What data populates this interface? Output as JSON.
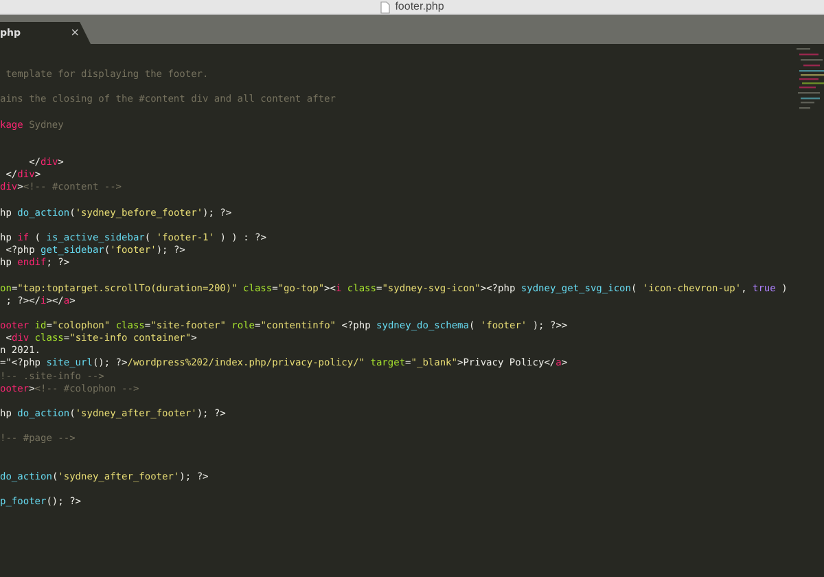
{
  "window": {
    "title": "footer.php"
  },
  "tabs": [
    {
      "label": "php",
      "close": "×",
      "selected": true
    }
  ],
  "editor": {
    "lines": [
      {
        "blank": true
      },
      {
        "tokens": [
          {
            "kind": "comment",
            "text": " template for displaying the footer."
          }
        ]
      },
      {
        "blank": true
      },
      {
        "tokens": [
          {
            "kind": "comment",
            "text": "ains the closing of the #content div and all content after"
          }
        ]
      },
      {
        "blank": true
      },
      {
        "tokens": [
          {
            "kind": "keyword",
            "text": "kage"
          },
          {
            "kind": "comment",
            "text": " Sydney"
          }
        ]
      },
      {
        "blank": true
      },
      {
        "blank": true
      },
      {
        "tokens": [
          {
            "kind": "plain",
            "text": "     </"
          },
          {
            "kind": "keyword",
            "text": "div"
          },
          {
            "kind": "plain",
            "text": ">"
          }
        ]
      },
      {
        "tokens": [
          {
            "kind": "plain",
            "text": " </"
          },
          {
            "kind": "keyword",
            "text": "div"
          },
          {
            "kind": "plain",
            "text": ">"
          }
        ]
      },
      {
        "tokens": [
          {
            "kind": "keyword",
            "text": "div"
          },
          {
            "kind": "plain",
            "text": ">"
          },
          {
            "kind": "comment",
            "text": "<!-- #content -->"
          }
        ]
      },
      {
        "blank": true
      },
      {
        "tokens": [
          {
            "kind": "plain",
            "text": "hp "
          },
          {
            "kind": "func",
            "text": "do_action"
          },
          {
            "kind": "plain",
            "text": "("
          },
          {
            "kind": "string",
            "text": "'sydney_before_footer'"
          },
          {
            "kind": "plain",
            "text": "); ?>"
          }
        ]
      },
      {
        "blank": true
      },
      {
        "tokens": [
          {
            "kind": "plain",
            "text": "hp "
          },
          {
            "kind": "keyword",
            "text": "if"
          },
          {
            "kind": "plain",
            "text": " ( "
          },
          {
            "kind": "func",
            "text": "is_active_sidebar"
          },
          {
            "kind": "plain",
            "text": "( "
          },
          {
            "kind": "string",
            "text": "'footer-1'"
          },
          {
            "kind": "plain",
            "text": " ) ) : ?>"
          }
        ]
      },
      {
        "tokens": [
          {
            "kind": "plain",
            "text": " <?php "
          },
          {
            "kind": "func",
            "text": "get_sidebar"
          },
          {
            "kind": "plain",
            "text": "("
          },
          {
            "kind": "string",
            "text": "'footer'"
          },
          {
            "kind": "plain",
            "text": "); ?>"
          }
        ]
      },
      {
        "tokens": [
          {
            "kind": "plain",
            "text": "hp "
          },
          {
            "kind": "keyword",
            "text": "endif"
          },
          {
            "kind": "plain",
            "text": "; ?>"
          }
        ]
      },
      {
        "blank": true
      },
      {
        "tokens": [
          {
            "kind": "attr",
            "text": "on"
          },
          {
            "kind": "plain",
            "text": "="
          },
          {
            "kind": "string",
            "text": "\"tap:toptarget.scrollTo(duration=200)\""
          },
          {
            "kind": "attr",
            "text": " class"
          },
          {
            "kind": "plain",
            "text": "="
          },
          {
            "kind": "string",
            "text": "\"go-top\""
          },
          {
            "kind": "plain",
            "text": "><"
          },
          {
            "kind": "keyword",
            "text": "i"
          },
          {
            "kind": "attr",
            "text": " class"
          },
          {
            "kind": "plain",
            "text": "="
          },
          {
            "kind": "string",
            "text": "\"sydney-svg-icon\""
          },
          {
            "kind": "plain",
            "text": "><?php "
          },
          {
            "kind": "func",
            "text": "sydney_get_svg_icon"
          },
          {
            "kind": "plain",
            "text": "( "
          },
          {
            "kind": "string",
            "text": "'icon-chevron-up'"
          },
          {
            "kind": "plain",
            "text": ", "
          },
          {
            "kind": "constant",
            "text": "true"
          },
          {
            "kind": "plain",
            "text": " )"
          }
        ]
      },
      {
        "tokens": [
          {
            "kind": "plain",
            "text": " ; ?></"
          },
          {
            "kind": "keyword",
            "text": "i"
          },
          {
            "kind": "plain",
            "text": "></"
          },
          {
            "kind": "keyword",
            "text": "a"
          },
          {
            "kind": "plain",
            "text": ">"
          }
        ]
      },
      {
        "blank": true
      },
      {
        "tokens": [
          {
            "kind": "keyword",
            "text": "ooter"
          },
          {
            "kind": "attr",
            "text": " id"
          },
          {
            "kind": "plain",
            "text": "="
          },
          {
            "kind": "string",
            "text": "\"colophon\""
          },
          {
            "kind": "attr",
            "text": " class"
          },
          {
            "kind": "plain",
            "text": "="
          },
          {
            "kind": "string",
            "text": "\"site-footer\""
          },
          {
            "kind": "attr",
            "text": " role"
          },
          {
            "kind": "plain",
            "text": "="
          },
          {
            "kind": "string",
            "text": "\"contentinfo\""
          },
          {
            "kind": "plain",
            "text": " <?php "
          },
          {
            "kind": "func",
            "text": "sydney_do_schema"
          },
          {
            "kind": "plain",
            "text": "( "
          },
          {
            "kind": "string",
            "text": "'footer'"
          },
          {
            "kind": "plain",
            "text": " ); ?>>"
          }
        ]
      },
      {
        "tokens": [
          {
            "kind": "plain",
            "text": " <"
          },
          {
            "kind": "keyword",
            "text": "div"
          },
          {
            "kind": "attr",
            "text": " class"
          },
          {
            "kind": "plain",
            "text": "="
          },
          {
            "kind": "string",
            "text": "\"site-info container\""
          },
          {
            "kind": "plain",
            "text": ">"
          }
        ]
      },
      {
        "tokens": [
          {
            "kind": "plain",
            "text": "n 2021."
          }
        ]
      },
      {
        "tokens": [
          {
            "kind": "plain",
            "text": "=\"<?php "
          },
          {
            "kind": "func",
            "text": "site_url"
          },
          {
            "kind": "plain",
            "text": "(); ?>"
          },
          {
            "kind": "string",
            "text": "/wordpress%202/index.php/privacy-policy/\""
          },
          {
            "kind": "attr",
            "text": " target"
          },
          {
            "kind": "plain",
            "text": "="
          },
          {
            "kind": "string",
            "text": "\"_blank\""
          },
          {
            "kind": "plain",
            "text": ">Privacy Policy</"
          },
          {
            "kind": "keyword",
            "text": "a"
          },
          {
            "kind": "plain",
            "text": ">"
          }
        ]
      },
      {
        "tokens": [
          {
            "kind": "comment",
            "text": "!-- .site-info -->"
          }
        ]
      },
      {
        "tokens": [
          {
            "kind": "keyword",
            "text": "ooter"
          },
          {
            "kind": "plain",
            "text": ">"
          },
          {
            "kind": "comment",
            "text": "<!-- #colophon -->"
          }
        ]
      },
      {
        "blank": true
      },
      {
        "tokens": [
          {
            "kind": "plain",
            "text": "hp "
          },
          {
            "kind": "func",
            "text": "do_action"
          },
          {
            "kind": "plain",
            "text": "("
          },
          {
            "kind": "string",
            "text": "'sydney_after_footer'"
          },
          {
            "kind": "plain",
            "text": "); ?>"
          }
        ]
      },
      {
        "blank": true
      },
      {
        "tokens": [
          {
            "kind": "comment",
            "text": "!-- #page -->"
          }
        ]
      },
      {
        "blank": true
      },
      {
        "blank": true
      },
      {
        "tokens": [
          {
            "kind": "func",
            "text": "do_action"
          },
          {
            "kind": "plain",
            "text": "("
          },
          {
            "kind": "string",
            "text": "'sydney_after_footer'"
          },
          {
            "kind": "plain",
            "text": "); ?>"
          }
        ]
      },
      {
        "blank": true
      },
      {
        "tokens": [
          {
            "kind": "func",
            "text": "p_footer"
          },
          {
            "kind": "plain",
            "text": "(); ?>"
          }
        ]
      }
    ]
  }
}
